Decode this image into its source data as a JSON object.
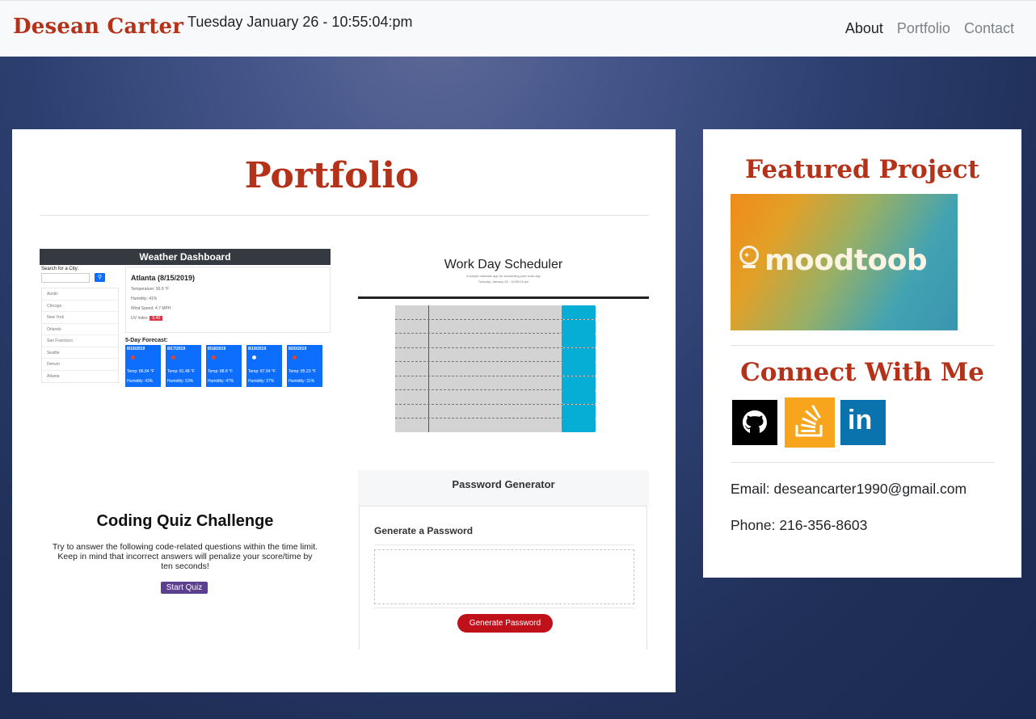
{
  "nav": {
    "brand": "Desean Carter",
    "datetime": "Tuesday January 26 - 10:55:04:pm",
    "links": [
      "About",
      "Portfolio",
      "Contact"
    ]
  },
  "main": {
    "title": "Portfolio",
    "weather": {
      "header": "Weather Dashboard",
      "search_label": "Search for a City:",
      "cities": [
        "Austin",
        "Chicago",
        "New York",
        "Orlando",
        "San Francisco",
        "Seattle",
        "Denver",
        "Atlanta"
      ],
      "current_city": "Atlanta (8/15/2019)",
      "temperature": "Temperature: 90.9 °F",
      "humidity": "Humidity: 41%",
      "wind": "Wind Speed: 4.7 MPH",
      "uv_label": "UV Index:",
      "uv_value": "9.49",
      "forecast_title": "5-Day Forecast:",
      "forecast": [
        {
          "date": "8/16/2019",
          "temp": "Temp: 86.84 °F",
          "humidity": "Humidity: 43%"
        },
        {
          "date": "8/17/2019",
          "temp": "Temp: 81.48 °F",
          "humidity": "Humidity: 53%"
        },
        {
          "date": "8/18/2019",
          "temp": "Temp: 88.8 °F",
          "humidity": "Humidity: 47%"
        },
        {
          "date": "8/19/2019",
          "temp": "Temp: 87.94 °F",
          "humidity": "Humidity: 37%"
        },
        {
          "date": "8/20/2019",
          "temp": "Temp: 85.23 °F",
          "humidity": "Humidity: 31%"
        }
      ]
    },
    "scheduler": {
      "title": "Work Day Scheduler",
      "subtitle": "A simple calendar app for scheduling your work day",
      "date": "Tuesday, January 26 - 10:55:04 pm"
    },
    "quiz": {
      "title": "Coding Quiz Challenge",
      "text": "Try to answer the following code-related questions within the time limit. Keep in mind that incorrect answers will penalize your score/time by ten seconds!",
      "button": "Start Quiz"
    },
    "password": {
      "header": "Password Generator",
      "label": "Generate a Password",
      "button": "Generate Password"
    }
  },
  "side": {
    "featured_title": "Featured Project",
    "featured_name": "moodtoob",
    "connect_title": "Connect With Me",
    "social_icons": [
      "github-icon",
      "stackoverflow-icon",
      "linkedin-icon"
    ],
    "linkedin_text": "in",
    "email": "Email: deseancarter1990@gmail.com",
    "phone": "Phone: 216-356-8603"
  },
  "colors": {
    "brand": "#b5321a",
    "github": "#000000",
    "stackoverflow": "#f7a51d",
    "linkedin": "#0a72ad"
  }
}
